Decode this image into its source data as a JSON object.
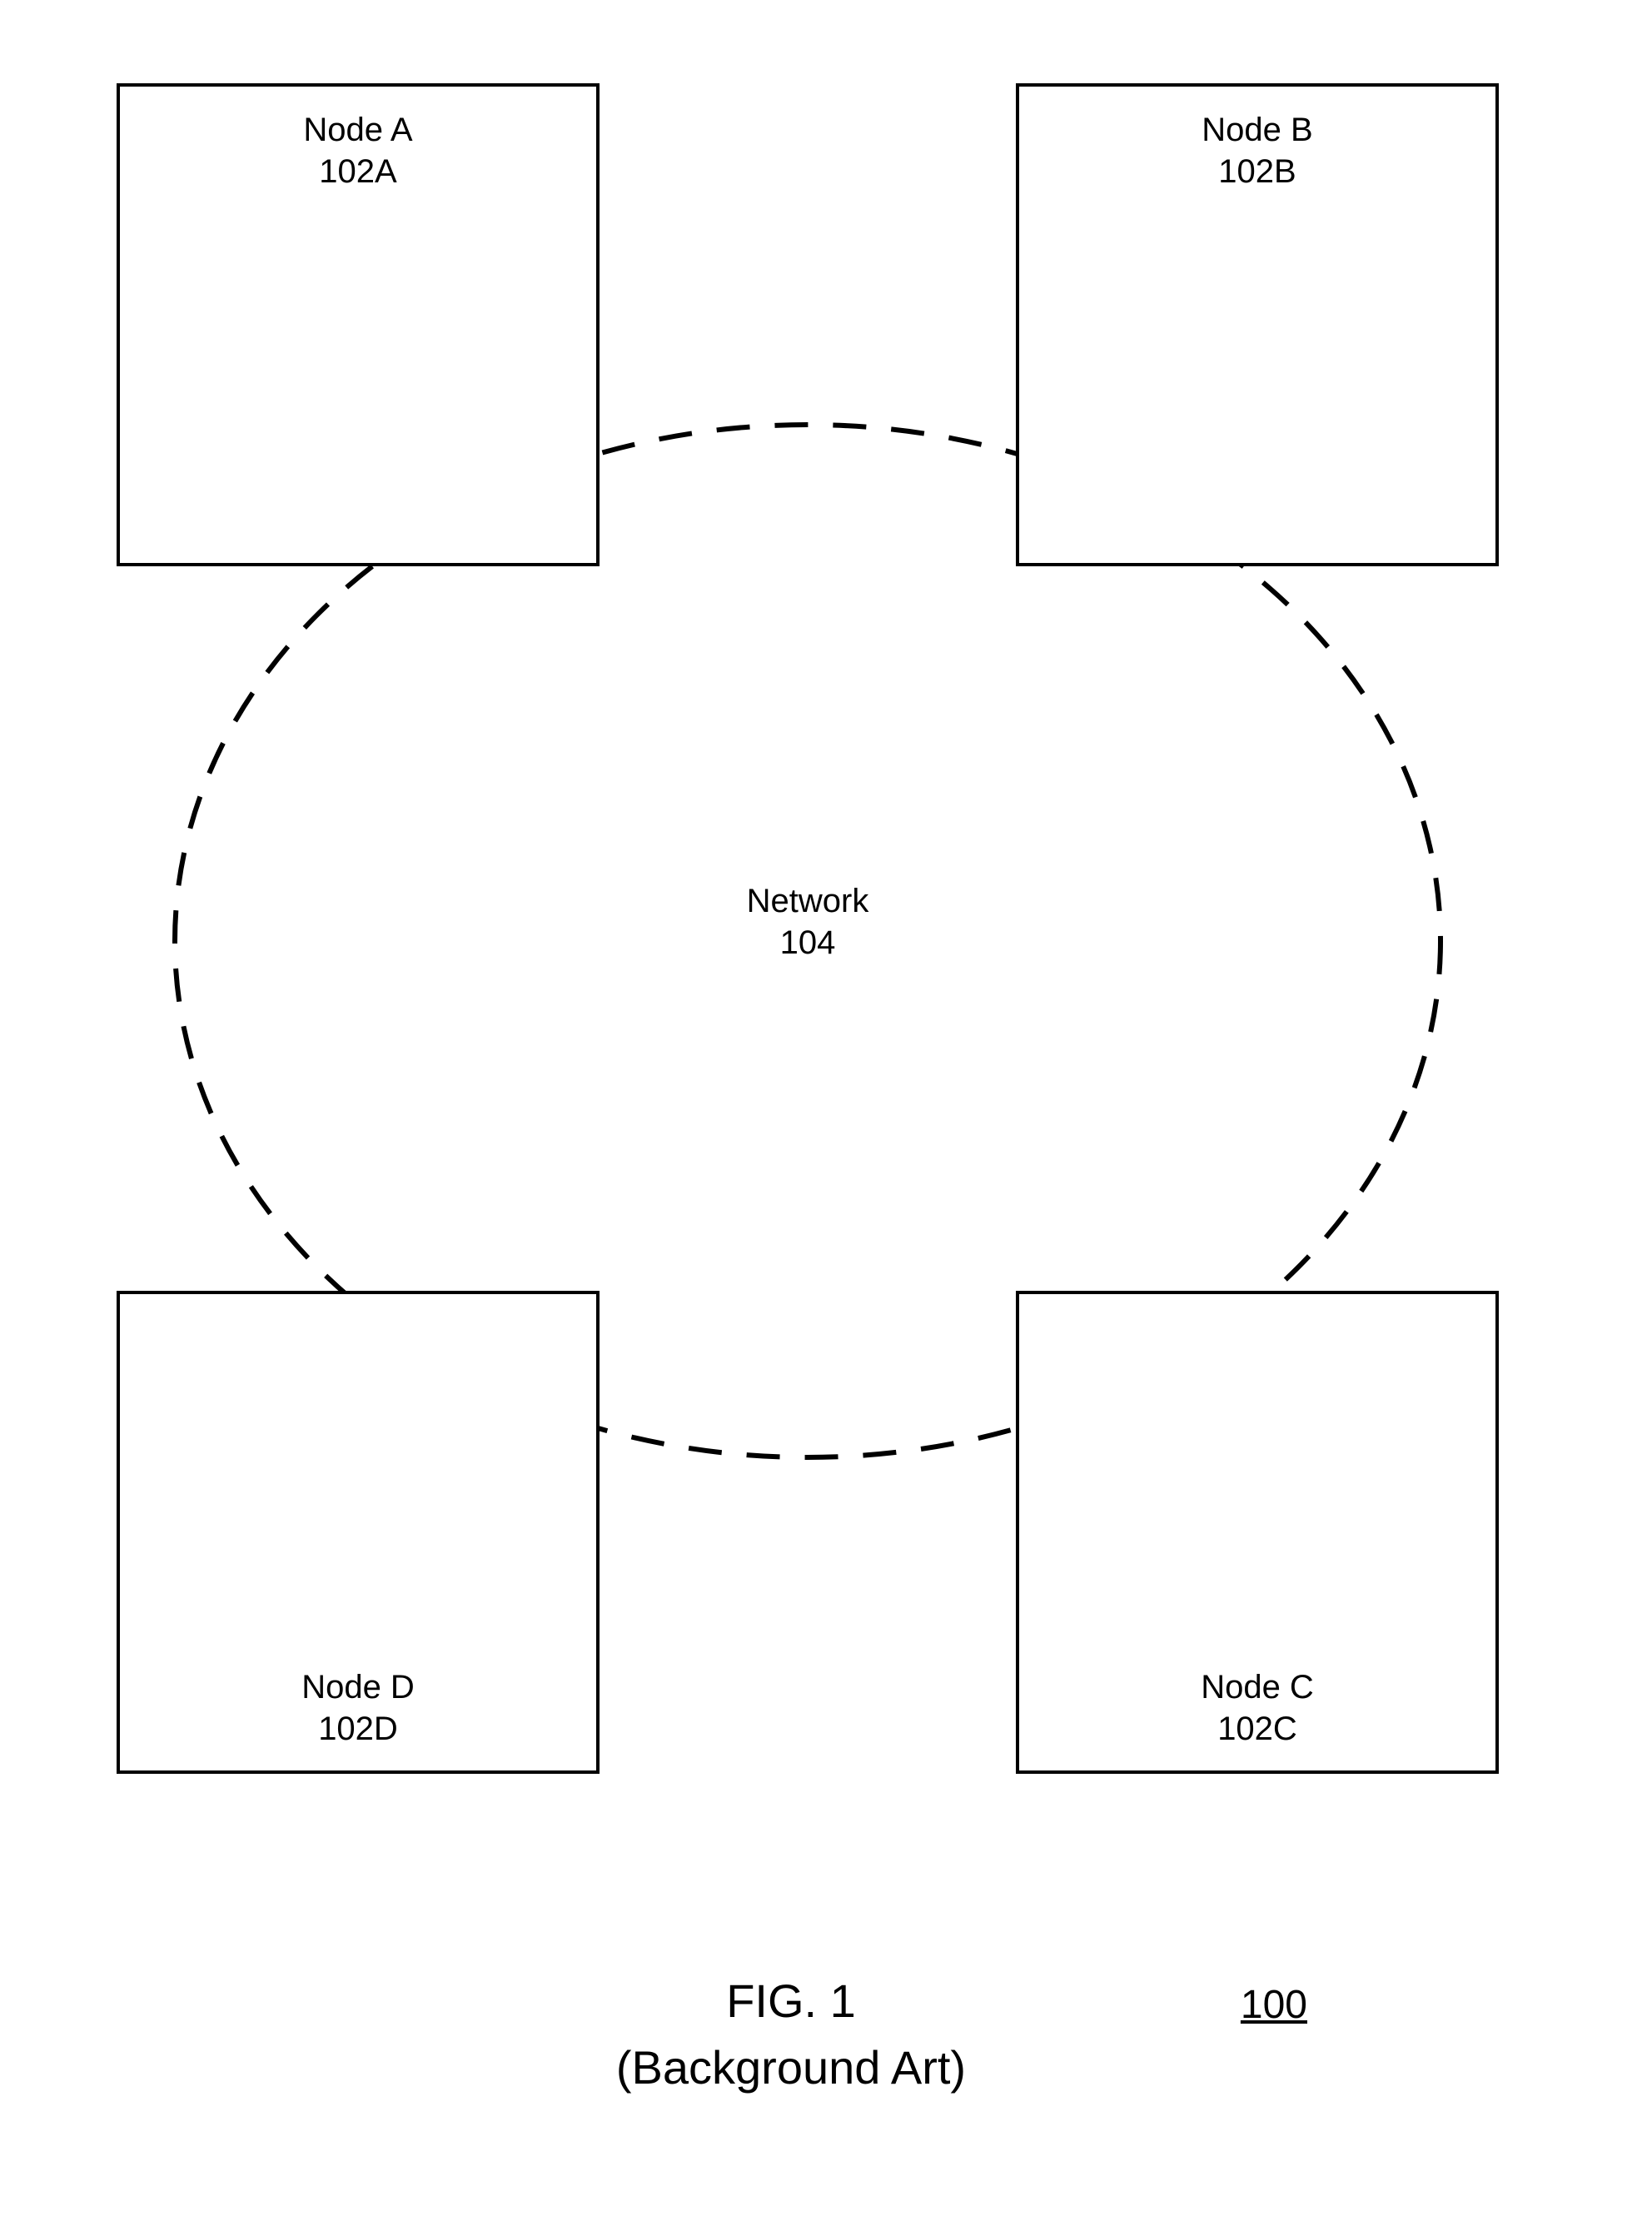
{
  "nodes": {
    "a": {
      "title": "Node A",
      "ref": "102A"
    },
    "b": {
      "title": "Node B",
      "ref": "102B"
    },
    "c": {
      "title": "Node C",
      "ref": "102C"
    },
    "d": {
      "title": "Node D",
      "ref": "102D"
    }
  },
  "network": {
    "title": "Network",
    "ref": "104"
  },
  "figure": {
    "title": "FIG. 1",
    "subtitle": "(Background Art)",
    "system_ref": "100"
  }
}
